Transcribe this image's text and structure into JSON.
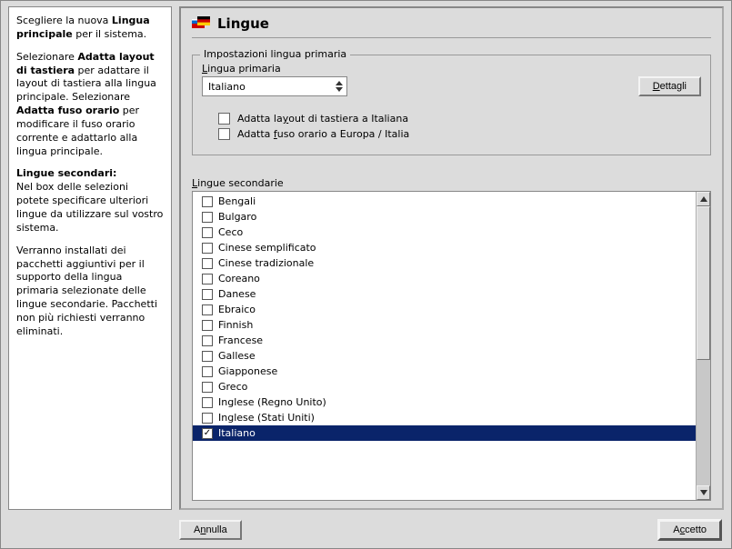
{
  "help": {
    "p1_pre": "Scegliere la nuova ",
    "p1_b": "Lingua principale",
    "p1_post": " per il sistema.",
    "p2_pre": "Selezionare ",
    "p2_b1": "Adatta layout di tastiera",
    "p2_mid": " per adattare il layout di tastiera alla lingua principale. Selezionare ",
    "p2_b2": "Adatta fuso orario",
    "p2_post": " per modificare il fuso orario corrente e adattarlo alla lingua principale.",
    "p3_b": "Lingue secondari:",
    "p3_rest": "Nel box delle selezioni potete specificare ulteriori lingue da utilizzare sul vostro sistema.",
    "p4": "Verranno installati dei pacchetti aggiuntivi per il supporto della lingua primaria selezionate delle lingue secondarie. Pacchetti non più richiesti verranno eliminati."
  },
  "header": {
    "title": "Lingue"
  },
  "primary": {
    "fieldset_legend": "Impostazioni lingua primaria",
    "label_pre": "L",
    "label_post": "ingua primaria",
    "value": "Italiano",
    "details_pre": "D",
    "details_post": "ettagli",
    "adapt_kb_pre": "Adatta la",
    "adapt_kb_u": "y",
    "adapt_kb_post": "out di tastiera a Italiana",
    "adapt_tz_pre": "Adatta ",
    "adapt_tz_u": "f",
    "adapt_tz_post": "uso orario a Europa / Italia"
  },
  "secondary": {
    "label_pre": "L",
    "label_post": "ingue secondarie",
    "items": [
      {
        "label": "Bengali",
        "checked": false,
        "selected": false
      },
      {
        "label": "Bulgaro",
        "checked": false,
        "selected": false
      },
      {
        "label": "Ceco",
        "checked": false,
        "selected": false
      },
      {
        "label": "Cinese semplificato",
        "checked": false,
        "selected": false
      },
      {
        "label": "Cinese tradizionale",
        "checked": false,
        "selected": false
      },
      {
        "label": "Coreano",
        "checked": false,
        "selected": false
      },
      {
        "label": "Danese",
        "checked": false,
        "selected": false
      },
      {
        "label": "Ebraico",
        "checked": false,
        "selected": false
      },
      {
        "label": "Finnish",
        "checked": false,
        "selected": false
      },
      {
        "label": "Francese",
        "checked": false,
        "selected": false
      },
      {
        "label": "Gallese",
        "checked": false,
        "selected": false
      },
      {
        "label": "Giapponese",
        "checked": false,
        "selected": false
      },
      {
        "label": "Greco",
        "checked": false,
        "selected": false
      },
      {
        "label": "Inglese (Regno Unito)",
        "checked": false,
        "selected": false
      },
      {
        "label": "Inglese (Stati Uniti)",
        "checked": false,
        "selected": false
      },
      {
        "label": "Italiano",
        "checked": true,
        "selected": true
      }
    ]
  },
  "buttons": {
    "cancel_pre": "A",
    "cancel_u": "n",
    "cancel_post": "nulla",
    "accept_pre": "A",
    "accept_u": "c",
    "accept_post": "cetto"
  }
}
